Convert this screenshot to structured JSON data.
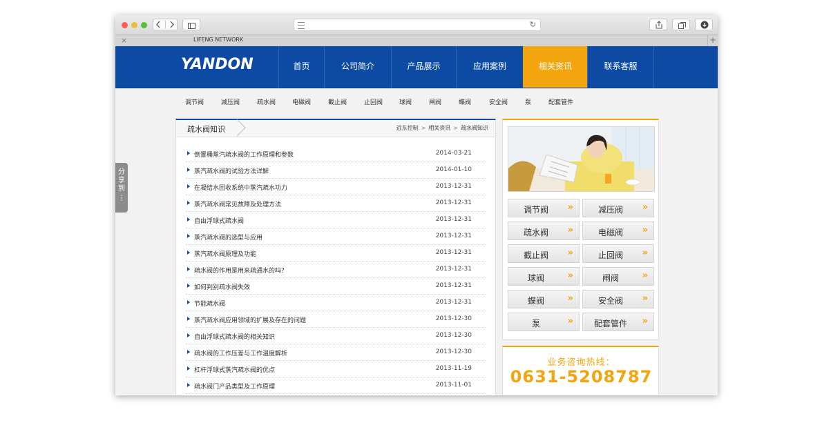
{
  "browser": {
    "tab_title": "LIFENG NETWORK",
    "close_glyph": "×",
    "plus_glyph": "+",
    "reload_glyph": "↻"
  },
  "site": {
    "logo": "YANDON",
    "nav": [
      "首页",
      "公司简介",
      "产品展示",
      "应用案例",
      "相关资讯",
      "联系客服"
    ],
    "nav_active_index": 4,
    "subnav": [
      "调节阀",
      "减压阀",
      "疏水阀",
      "电磁阀",
      "截止阀",
      "止回阀",
      "球阀",
      "闸阀",
      "蝶阀",
      "安全阀",
      "泵",
      "配套管件"
    ]
  },
  "list_panel": {
    "title": "疏水阀知识",
    "breadcrumb": [
      "远东控制",
      "相关资讯",
      "疏水阀知识"
    ],
    "breadcrumb_sep": ">",
    "articles": [
      {
        "title": "倒置桶蒸汽疏水阀的工作原理和参数",
        "date": "2014-03-21"
      },
      {
        "title": "蒸汽疏水阀的试验方法详解",
        "date": "2014-01-10"
      },
      {
        "title": "在凝结水回收系统中蒸汽疏水功力",
        "date": "2013-12-31"
      },
      {
        "title": "蒸汽疏水阀常见故障及处理方法",
        "date": "2013-12-31"
      },
      {
        "title": "自由浮球式疏水阀",
        "date": "2013-12-31"
      },
      {
        "title": "蒸汽疏水阀的选型与应用",
        "date": "2013-12-31"
      },
      {
        "title": "蒸汽疏水阀原理及功能",
        "date": "2013-12-31"
      },
      {
        "title": "疏水阀的作用是用来疏通水的吗？",
        "date": "2013-12-31"
      },
      {
        "title": "如何判别疏水阀失效",
        "date": "2013-12-31"
      },
      {
        "title": "节能疏水阀",
        "date": "2013-12-31"
      },
      {
        "title": "蒸汽疏水阀应用领域的扩展及存在的问题",
        "date": "2013-12-30"
      },
      {
        "title": "自由浮球式疏水阀的相关知识",
        "date": "2013-12-30"
      },
      {
        "title": "疏水阀的工作压差与工作温度解析",
        "date": "2013-12-30"
      },
      {
        "title": "杠杆浮球式蒸汽疏水阀的优点",
        "date": "2013-11-19"
      },
      {
        "title": "疏水阀门产品类型及工作原理",
        "date": "2013-11-01"
      }
    ]
  },
  "side_panel": {
    "buttons": [
      "调节阀",
      "减压阀",
      "疏水阀",
      "电磁阀",
      "截止阀",
      "止回阀",
      "球阀",
      "闸阀",
      "蝶阀",
      "安全阀",
      "泵",
      "配套管件"
    ],
    "arrow_glyph": "»"
  },
  "hotline": {
    "label": "业务咨询热线：",
    "phone": "0631-5208787"
  },
  "share": {
    "label": "分享到"
  },
  "colors": {
    "primary_blue": "#0c4aa3",
    "accent_orange": "#f3a50f"
  }
}
